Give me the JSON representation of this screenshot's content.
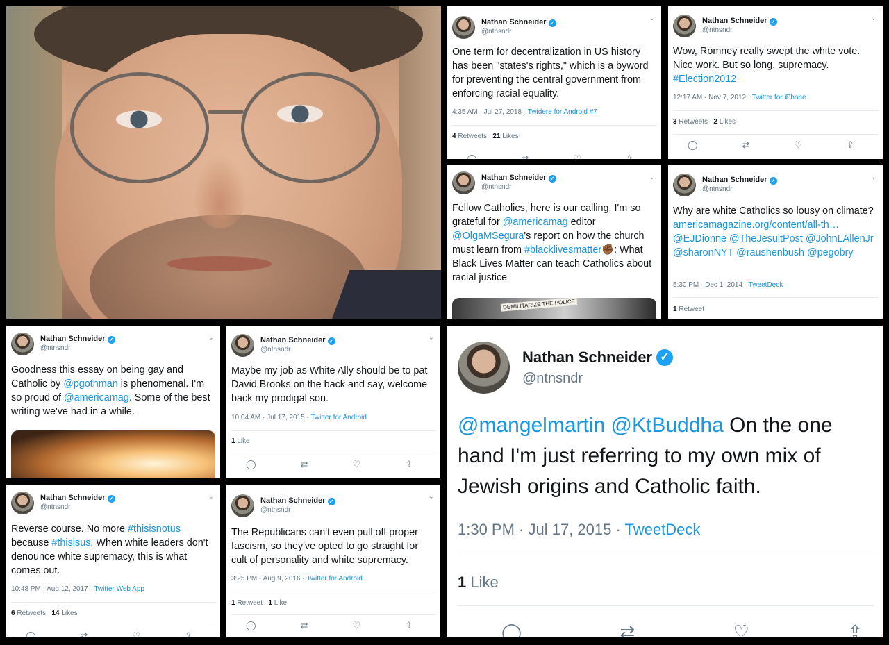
{
  "photo": {
    "alt": "photo"
  },
  "author": {
    "name": "Nathan Schneider",
    "handle": "@ntnsndr",
    "verified_glyph": "✓"
  },
  "icons": {
    "chevron": "⌄",
    "reply": "◯",
    "retweet": "⇄",
    "like": "♡",
    "share": "⇪"
  },
  "tweets": {
    "t1": {
      "text": "One term for decentralization in US history has been \"states's rights,\" which is a byword for preventing the central government from enforcing racial equality.",
      "time": "4:35 AM · Jul 27, 2018 · ",
      "source": "Twidere for Android #7",
      "retweets_n": "4",
      "retweets_l": " Retweets",
      "likes_n": "21",
      "likes_l": " Likes"
    },
    "t2": {
      "text_a": "Wow, Romney really swept the white vote. Nice work. But so long, supremacy.",
      "tag": "#Election2012",
      "time": "12:17 AM · Nov 7, 2012 · ",
      "source": "Twitter for iPhone",
      "retweets_n": "3",
      "retweets_l": " Retweets",
      "likes_n": "2",
      "likes_l": " Likes"
    },
    "t3": {
      "p1": "Fellow Catholics, here is our calling. I'm so grateful for ",
      "m1": "@americamag",
      "p2": " editor ",
      "m2": "@OlgaMSegura",
      "p3": "'s report on how the church must learn from ",
      "m3": "#blacklivesmatter",
      "emoji": "✊🏾",
      "p4": ": What Black Lives Matter can teach Catholics about racial justice",
      "media_label": "DEMILITARIZE THE POLICE"
    },
    "t4": {
      "p1": "Why are white Catholics so lousy on climate? ",
      "l1": "americamagazine.org/content/all-th…",
      "m1": " @EJDionne",
      "m2": " @TheJesuitPost",
      "m3": "@JohnLAllenJr",
      "m4": " @sharonNYT",
      "m5": "@raushenbush",
      "m6": " @pegobry",
      "time": "5:30 PM · Dec 1, 2014 · ",
      "source": "TweetDeck",
      "retweets_n": "1",
      "retweets_l": " Retweet"
    },
    "t5": {
      "p1": "Goodness this essay on being gay and Catholic by ",
      "m1": "@pgothman",
      "p2": " is phenomenal. I'm so proud of ",
      "m2": "@americamag",
      "p3": ". Some of the best writing we've had in a while."
    },
    "t6": {
      "text": "Maybe my job as White Ally should be to pat David Brooks on the back and say, welcome back my prodigal son.",
      "time": "10:04 AM · Jul 17, 2015 · ",
      "source": "Twitter for Android",
      "likes_n": "1",
      "likes_l": " Like"
    },
    "t7": {
      "p1": "Reverse course. No more ",
      "m1": "#thisisnotus",
      "p2": " because ",
      "m2": "#thisisus",
      "p3": ". When white leaders don't denounce white supremacy, this is what comes out.",
      "time": "10:48 PM · Aug 12, 2017 · ",
      "source": "Twitter Web App",
      "retweets_n": "6",
      "retweets_l": " Retweets",
      "likes_n": "14",
      "likes_l": " Likes"
    },
    "t8": {
      "text": "The Republicans can't even pull off proper fascism, so they've opted to go straight for cult of personality and white supremacy.",
      "time": "3:25 PM · Aug 9, 2016 · ",
      "source": "Twitter for Android",
      "retweets_n": "1",
      "retweets_l": " Retweet",
      "likes_n": "1",
      "likes_l": " Like"
    },
    "t9": {
      "m1": "@mangelmartin",
      "m2": " @KtBuddha",
      "p1": " On the one hand I'm just referring to my own mix of Jewish origins and Catholic faith.",
      "time": "1:30 PM · Jul 17, 2015 · ",
      "source": "TweetDeck",
      "likes_n": "1",
      "likes_l": " Like"
    }
  }
}
